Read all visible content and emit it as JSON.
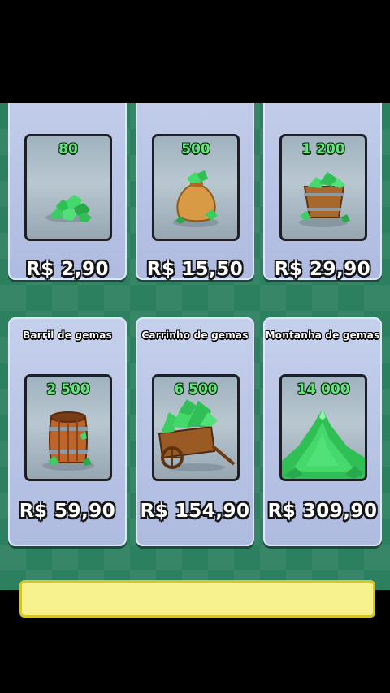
{
  "colors": {
    "background": "#2c7f5f",
    "card": "#b8c4e6",
    "gem_green": "#3fd36a",
    "amount_text": "#63e57b"
  },
  "offers": [
    {
      "title": "",
      "gems": "80",
      "price": "R$ 2,90",
      "icon": "gem-pile-icon"
    },
    {
      "title": "",
      "gems": "500",
      "price": "R$ 15,50",
      "icon": "gem-bag-icon"
    },
    {
      "title": "",
      "gems": "1 200",
      "price": "R$ 29,90",
      "icon": "gem-bucket-icon"
    },
    {
      "title": "Barril de gemas",
      "gems": "2 500",
      "price": "R$ 59,90",
      "icon": "gem-barrel-icon"
    },
    {
      "title": "Carrinho de gemas",
      "gems": "6 500",
      "price": "R$ 154,90",
      "icon": "gem-cart-icon"
    },
    {
      "title": "Montanha de gemas",
      "gems": "14 000",
      "price": "R$ 309,90",
      "icon": "gem-mountain-icon"
    }
  ]
}
